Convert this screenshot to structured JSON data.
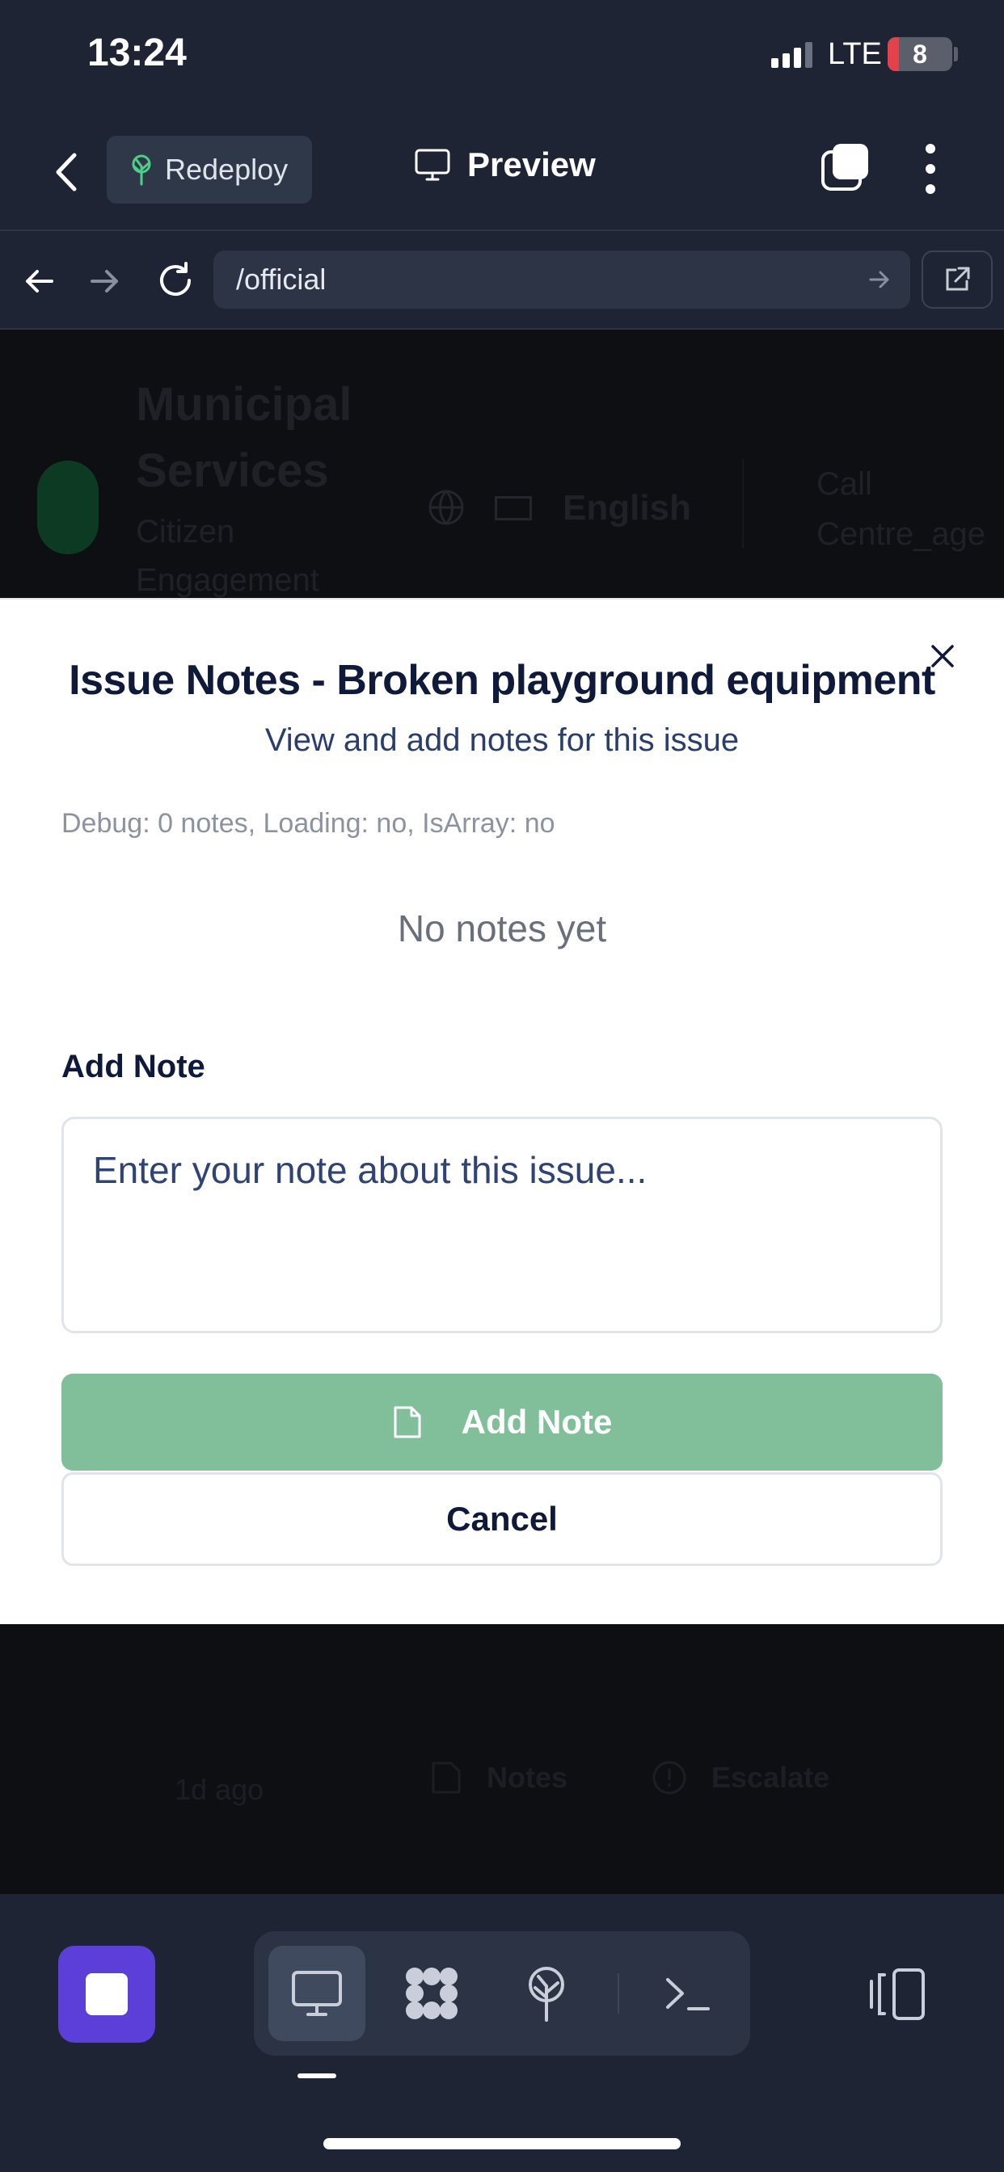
{
  "status_bar": {
    "time": "13:24",
    "network": "LTE",
    "battery": "8"
  },
  "header": {
    "redeploy_label": "Redeploy",
    "preview_label": "Preview"
  },
  "url_bar": {
    "value": "/official"
  },
  "background_page": {
    "title": "Municipal Services",
    "subtitle": "Citizen Engagement",
    "language": "English",
    "call": "Call Centre_age",
    "time_ago": "1d ago",
    "notes_label": "Notes",
    "escalate_label": "Escalate"
  },
  "modal": {
    "title": "Issue Notes - Broken playground equipment",
    "subtitle": "View and add notes for this issue",
    "debug": "Debug: 0 notes, Loading: no, IsArray: no",
    "empty_text": "No notes yet",
    "add_note_label": "Add Note",
    "placeholder": "Enter your note about this issue...",
    "add_button": "Add Note",
    "cancel_button": "Cancel"
  },
  "colors": {
    "chrome_bg": "#1e2434",
    "accent_purple": "#5b3fd8",
    "add_button_green": "#80bf9a",
    "title_navy": "#0f1a3a"
  }
}
